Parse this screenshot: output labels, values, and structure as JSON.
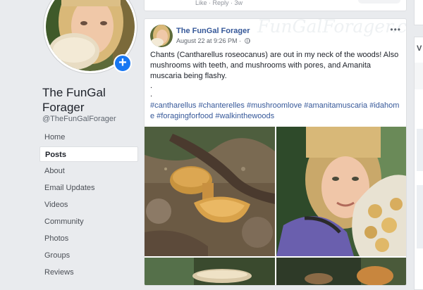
{
  "page": {
    "name": "The FunGal Forager",
    "handle": "@TheFunGalForager",
    "add_photo_symbol": "+"
  },
  "nav": {
    "items": [
      {
        "label": "Home",
        "active": false
      },
      {
        "label": "Posts",
        "active": true
      },
      {
        "label": "About",
        "active": false
      },
      {
        "label": "Email Updates",
        "active": false
      },
      {
        "label": "Videos",
        "active": false
      },
      {
        "label": "Community",
        "active": false
      },
      {
        "label": "Photos",
        "active": false
      },
      {
        "label": "Groups",
        "active": false
      },
      {
        "label": "Reviews",
        "active": false
      }
    ]
  },
  "previous_post": {
    "actions_text": "Like · Reply · 3w"
  },
  "post": {
    "author": "The FunGal Forager",
    "timestamp": "August 22 at 9:26 PM · ",
    "more_label": "•••",
    "watermark": "FunGalForager.com",
    "body": "Chants (Cantharellus roseocanus) are out in my neck of the woods! Also mushrooms with teeth, and mushrooms with pores, and Amanita muscaria being flashy.",
    "dots": ".\n.",
    "hashtags": "#cantharellus #chanterelles #mushroomlove #amanitamuscaria #idahome #foragingforfood #walkinthewoods",
    "photos": [
      {
        "subject": "chanterelle mushrooms on forest floor"
      },
      {
        "subject": "woman holding bag of chanterelles"
      },
      {
        "subject": "mushroom photo"
      },
      {
        "subject": "mushroom photo"
      }
    ]
  },
  "right_column": {
    "header_letter": "V"
  },
  "colors": {
    "background": "#e9ebee",
    "link_blue": "#365899",
    "accent_blue": "#1877f2"
  }
}
